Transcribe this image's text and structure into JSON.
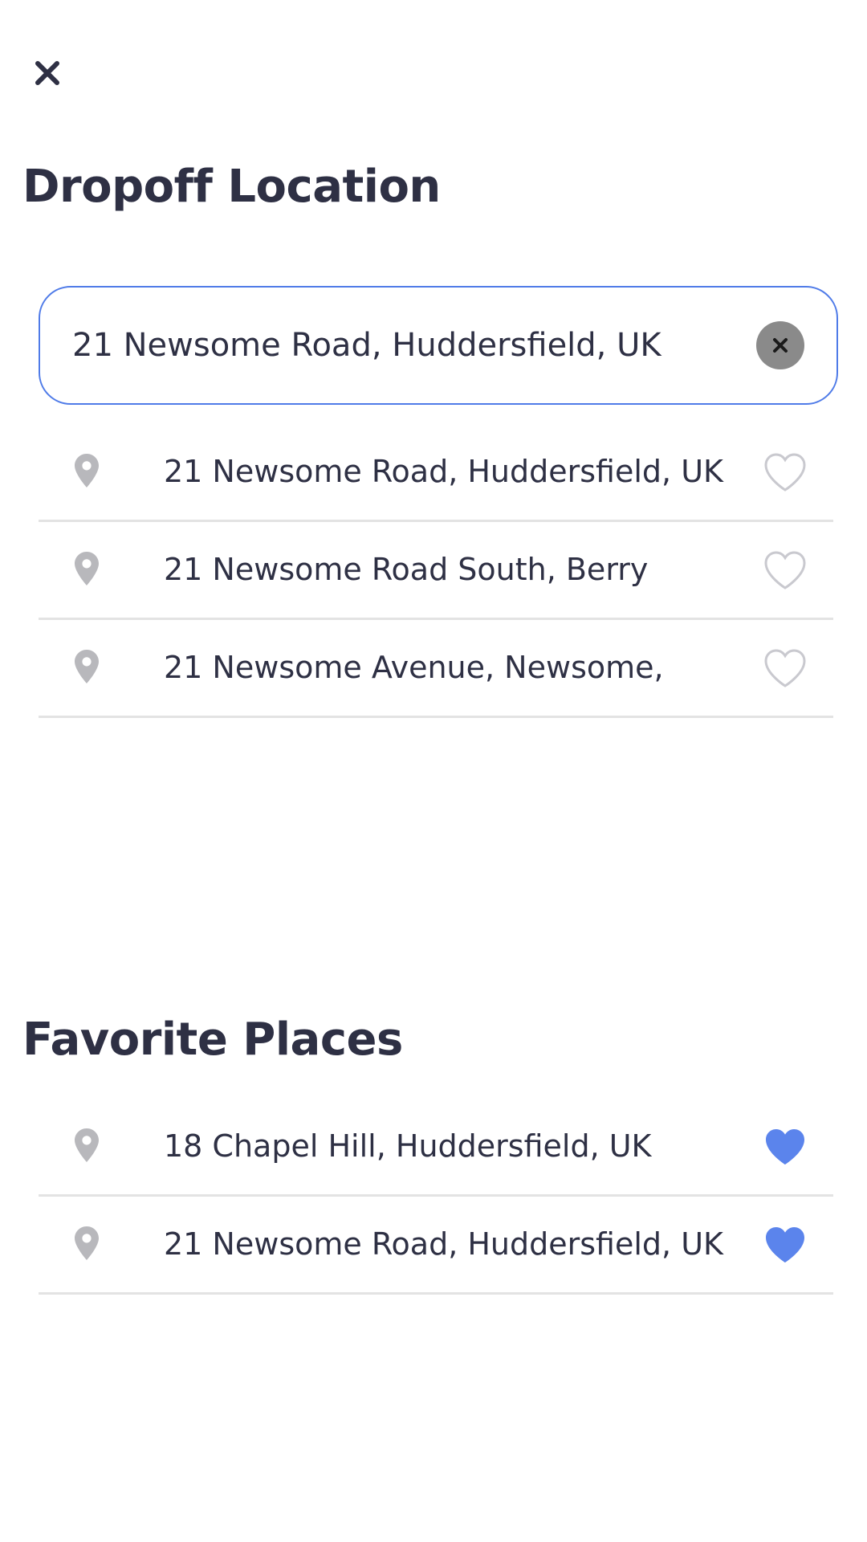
{
  "header": {
    "close_icon": "close-icon",
    "title": "Dropoff Location"
  },
  "search": {
    "value": "21 Newsome Road, Huddersfield, UK",
    "clear_icon": "clear-icon"
  },
  "suggestions": [
    {
      "label": "21 Newsome Road, Huddersfield, UK",
      "icon": "location-pin-icon",
      "favorite": false
    },
    {
      "label": "21 Newsome Road South, Berry",
      "icon": "location-pin-icon",
      "favorite": false
    },
    {
      "label": "21 Newsome Avenue, Newsome,",
      "icon": "location-pin-icon",
      "favorite": false
    }
  ],
  "favorites": {
    "title": "Favorite Places",
    "items": [
      {
        "label": "18 Chapel Hill, Huddersfield, UK",
        "icon": "location-pin-icon",
        "favorite": true
      },
      {
        "label": "21 Newsome Road, Huddersfield, UK",
        "icon": "location-pin-icon",
        "favorite": true
      }
    ]
  },
  "colors": {
    "accent": "#4f7be8",
    "text": "#2e3044",
    "pin": "#b8b8bc",
    "heart_outline": "#c9c9cf",
    "heart_filled": "#5b84ec",
    "clear_button": "#8a8a8a",
    "divider": "#e3e3e3"
  }
}
